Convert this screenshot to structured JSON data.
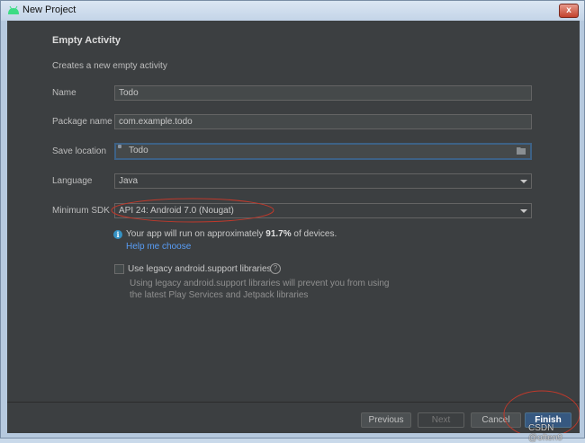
{
  "window": {
    "title": "New Project",
    "close_glyph": "x",
    "app_icon": "android-icon"
  },
  "page": {
    "section_title": "Empty Activity",
    "description": "Creates a new empty activity"
  },
  "form": {
    "name": {
      "label": "Name",
      "value": "Todo"
    },
    "package": {
      "label": "Package name",
      "value": "com.example.todo"
    },
    "save_location": {
      "label": "Save location",
      "value": "Todo",
      "icon": "folder-icon"
    },
    "language": {
      "label": "Language",
      "value": "Java"
    },
    "min_sdk": {
      "label": "Minimum SDK",
      "value": "API 24: Android 7.0 (Nougat)"
    }
  },
  "sdk_info": {
    "icon": "info-icon",
    "prefix": "Your app will run on approximately ",
    "percent": "91.7%",
    "suffix": " of devices.",
    "help_link": "Help me choose"
  },
  "legacy": {
    "checked": false,
    "label": "Use legacy android.support libraries",
    "help_icon": "question-icon",
    "description_line1": "Using legacy android.support libraries will prevent you from using",
    "description_line2": "the latest Play Services and Jetpack libraries"
  },
  "buttons": {
    "previous": "Previous",
    "next": "Next",
    "cancel": "Cancel",
    "finish": "Finish"
  },
  "watermark": "CSDN @often9",
  "colors": {
    "background": "#3c3f41",
    "accent": "#365880",
    "link": "#589df6",
    "annotation": "#c0392b"
  }
}
